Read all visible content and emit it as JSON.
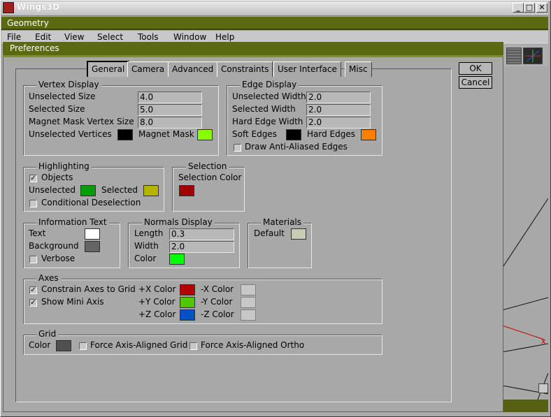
{
  "app": {
    "title": "Wings3D",
    "minimize": "_",
    "restore": "□",
    "close": "✕"
  },
  "geometry": {
    "title": "Geometry"
  },
  "menu": [
    "File",
    "Edit",
    "View",
    "Select",
    "Tools",
    "Window",
    "Help"
  ],
  "dialog": {
    "title": "Preferences",
    "ok": "OK",
    "cancel": "Cancel",
    "tabs": [
      "General",
      "Camera",
      "Advanced",
      "Constraints",
      "User Interface",
      "Misc"
    ],
    "active_tab": "General"
  },
  "vertex_display": {
    "title": "Vertex Display",
    "unselected_size_label": "Unselected Size",
    "unselected_size": "4.0",
    "selected_size_label": "Selected Size",
    "selected_size": "5.0",
    "magnet_mask_size_label": "Magnet Mask Vertex Size",
    "magnet_mask_size": "8.0",
    "unselected_vertices_label": "Unselected Vertices",
    "unselected_vertices_color": "#000000",
    "magnet_mask_label": "Magnet Mask",
    "magnet_mask_color": "#88ff00"
  },
  "edge_display": {
    "title": "Edge Display",
    "unselected_width_label": "Unselected Width",
    "unselected_width": "2.0",
    "selected_width_label": "Selected Width",
    "selected_width": "2.0",
    "hard_edge_width_label": "Hard Edge Width",
    "hard_edge_width": "2.0",
    "soft_edges_label": "Soft Edges",
    "soft_edges_color": "#000000",
    "hard_edges_label": "Hard Edges",
    "hard_edges_color": "#ff8000",
    "anti_aliased_label": "Draw Anti-Aliased Edges",
    "anti_aliased": false
  },
  "highlighting": {
    "title": "Highlighting",
    "objects_label": "Objects",
    "objects": true,
    "unselected_label": "Unselected",
    "unselected_color": "#00a000",
    "selected_label": "Selected",
    "selected_color": "#b4b400",
    "conditional_label": "Conditional Deselection",
    "conditional": false
  },
  "selection": {
    "title": "Selection",
    "color_label": "Selection Color",
    "color": "#a00000"
  },
  "info_text": {
    "title": "Information Text",
    "text_label": "Text",
    "text_color": "#ffffff",
    "background_label": "Background",
    "background_color": "#646464",
    "verbose_label": "Verbose",
    "verbose": false
  },
  "normals": {
    "title": "Normals Display",
    "length_label": "Length",
    "length": "0.3",
    "width_label": "Width",
    "width": "2.0",
    "color_label": "Color",
    "color": "#00ff00"
  },
  "materials": {
    "title": "Materials",
    "default_label": "Default",
    "default_color": "#c8ccb4"
  },
  "axes": {
    "title": "Axes",
    "constrain_label": "Constrain Axes to Grid",
    "constrain": true,
    "mini_axis_label": "Show Mini Axis",
    "mini_axis": true,
    "px_label": "+X Color",
    "px_color": "#b40000",
    "nx_label": "-X Color",
    "nx_color": "#c8c8c8",
    "py_label": "+Y Color",
    "py_color": "#50c800",
    "ny_label": "-Y Color",
    "ny_color": "#c8c8c8",
    "pz_label": "+Z Color",
    "pz_color": "#0050c8",
    "nz_label": "-Z Color",
    "nz_color": "#c8c8c8"
  },
  "grid": {
    "title": "Grid",
    "color_label": "Color",
    "color": "#505050",
    "force_grid_label": "Force Axis-Aligned Grid",
    "force_grid": false,
    "force_ortho_label": "Force Axis-Aligned Ortho",
    "force_ortho": false
  }
}
